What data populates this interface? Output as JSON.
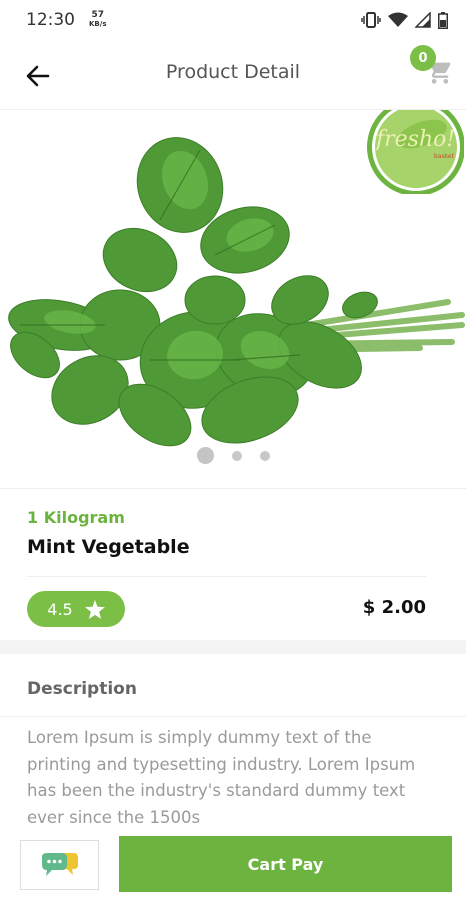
{
  "status_bar": {
    "time": "12:30",
    "speed_value": "57",
    "speed_unit": "KB/s"
  },
  "header": {
    "title": "Product Detail",
    "cart_count": "0"
  },
  "product": {
    "unit": "1 Kilogram",
    "name": "Mint Vegetable",
    "rating": "4.5",
    "price": "$ 2.00",
    "image_count": 3,
    "active_image_index": 0
  },
  "brand": {
    "logo_text": "fresho!",
    "logo_subtext": "basket"
  },
  "description": {
    "heading": "Description",
    "body": "Lorem Ipsum is simply dummy text of the printing and typesetting industry. Lorem Ipsum has been the industry's standard dummy text ever since the 1500s"
  },
  "actions": {
    "cart_pay_label": "Cart Pay"
  },
  "icons": {
    "back": "arrow-left-icon",
    "cart": "shopping-cart-icon",
    "star": "star-icon",
    "chat": "chat-bubbles-icon"
  },
  "colors": {
    "accent_green": "#6cb33f",
    "badge_green": "#7bbf47",
    "chat_green": "#5fb98a",
    "chat_yellow": "#f0c330"
  }
}
